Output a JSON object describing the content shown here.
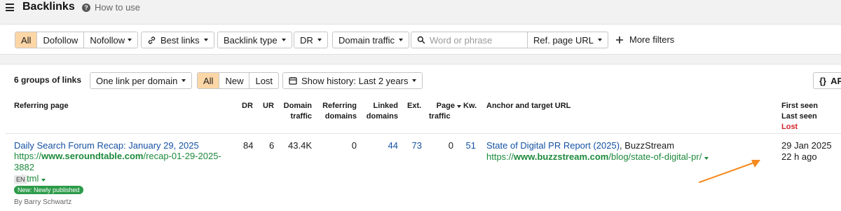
{
  "header": {
    "title": "Backlinks",
    "help_label": "How to use",
    "help_icon": "question-circle-icon"
  },
  "filters": {
    "link_type": {
      "options": [
        "All",
        "Dofollow",
        "Nofollow"
      ],
      "active": "All"
    },
    "best_links": "Best links",
    "backlink_type": "Backlink type",
    "dr": "DR",
    "domain_traffic": "Domain traffic",
    "search_placeholder": "Word or phrase",
    "ref_page_url": "Ref. page URL",
    "more_filters": "More filters"
  },
  "table_toolbar": {
    "groups_label": "6 groups of links",
    "grouping": "One link per domain",
    "status_tabs": [
      "All",
      "New",
      "Lost"
    ],
    "active_status": "All",
    "history": "Show history: Last 2 years",
    "api_label": "AP"
  },
  "columns": {
    "referring_page": "Referring page",
    "dr": "DR",
    "ur": "UR",
    "domain_traffic": [
      "Domain",
      "traffic"
    ],
    "referring_domains": [
      "Referring",
      "domains"
    ],
    "linked_domains": [
      "Linked",
      "domains"
    ],
    "ext": "Ext.",
    "page_traffic": [
      "Page",
      "traffic"
    ],
    "kw": "Kw.",
    "anchor": "Anchor and target URL",
    "first_seen": "First seen",
    "last_seen": "Last seen",
    "lost": "Lost"
  },
  "rows": [
    {
      "title": "Daily Search Forum Recap: January 29, 2025",
      "url_prefix": "https://",
      "url_domain": "www.seroundtable.com",
      "url_path_line1": "/recap-01-29-2025-3882",
      "url_path_line2": "1.html",
      "lang": "EN",
      "badge": "New: Newly published",
      "author": "By Barry Schwartz",
      "dr": "84",
      "ur": "6",
      "domain_traffic": "43.4K",
      "referring_domains": "0",
      "linked_domains": "44",
      "ext": "73",
      "page_traffic": "0",
      "kw": "51",
      "anchor_text": "State of Digital PR Report (2025)",
      "anchor_suffix": ", BuzzStream",
      "target_prefix": "https://",
      "target_domain": "www.buzzstream.com",
      "target_path": "/blog/state-of-digital-pr/",
      "first_seen": "29 Jan 2025",
      "last_seen": "22 h ago"
    }
  ],
  "colors": {
    "accent_orange": "#f58a1f",
    "active_bg": "#fcd6a6",
    "link_blue": "#1552a3",
    "url_green": "#1d8a3c",
    "lost_red": "#d4252b"
  }
}
